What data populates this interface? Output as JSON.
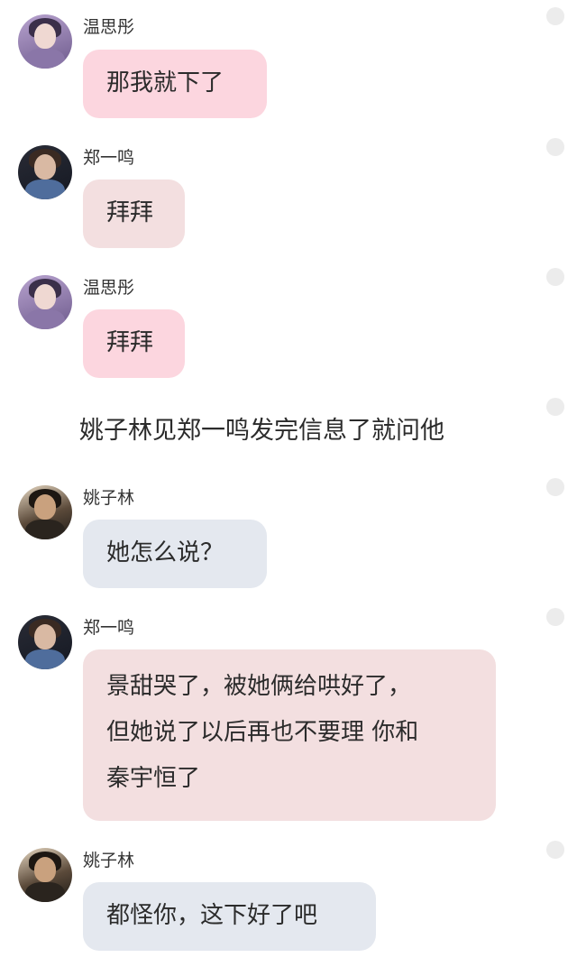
{
  "messages": [
    {
      "sender": "温思彤",
      "text": "那我就下了"
    },
    {
      "sender": "郑一鸣",
      "text": "拜拜"
    },
    {
      "sender": "温思彤",
      "text": "拜拜"
    },
    {
      "sender": "姚子林",
      "text": "她怎么说？"
    },
    {
      "sender": "郑一鸣",
      "lines": [
        "景甜哭了，被她俩给哄好了，",
        "但她说了以后再也不要理 你和",
        "秦宇恒了"
      ]
    },
    {
      "sender": "姚子林",
      "text": "都怪你，这下好了吧"
    }
  ],
  "narration": "姚子林见郑一鸣发完信息了就问他",
  "colors": {
    "bubble_wen": "#fcd6df",
    "bubble_zheng": "#f3dfe0",
    "bubble_yao": "#e4e8ef",
    "dot": "#ececec"
  }
}
